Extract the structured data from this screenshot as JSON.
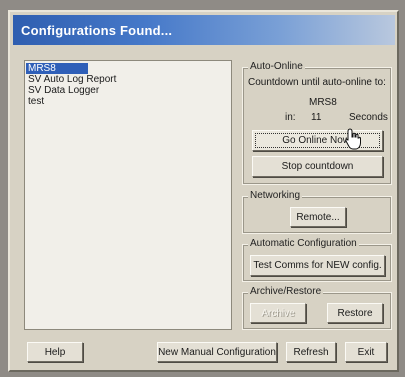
{
  "window": {
    "title": "Configurations Found..."
  },
  "configurations": [
    "MRS8",
    "SV Auto Log Report",
    "SV Data Logger",
    "test"
  ],
  "auto_online": {
    "group_label": "Auto-Online",
    "countdown_text": "Countdown until auto-online to:",
    "target": "MRS8",
    "in_label": "in:",
    "seconds_value": "11",
    "seconds_label": "Seconds",
    "go_online_label": "Go Online Now!",
    "stop_label": "Stop countdown"
  },
  "networking": {
    "group_label": "Networking",
    "remote_label": "Remote..."
  },
  "automatic_configuration": {
    "group_label": "Automatic Configuration",
    "test_comms_label": "Test Comms for NEW config."
  },
  "archive_restore": {
    "group_label": "Archive/Restore",
    "archive_label": "Archive",
    "restore_label": "Restore"
  },
  "footer": {
    "help_label": "Help",
    "new_manual_label": "New Manual Configuration",
    "refresh_label": "Refresh",
    "exit_label": "Exit"
  }
}
